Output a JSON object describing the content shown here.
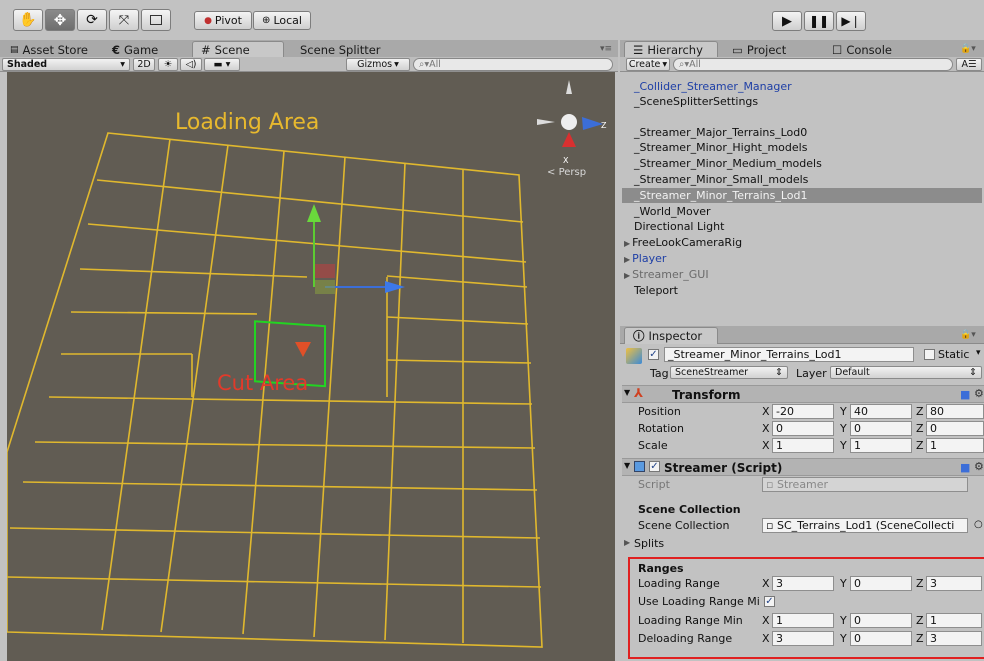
{
  "toolbar": {
    "pivot_label": "Pivot",
    "local_label": "Local"
  },
  "scene_panel": {
    "tabs": [
      {
        "label": "Asset Store"
      },
      {
        "label": "Game"
      },
      {
        "label": "Scene"
      },
      {
        "label": "Scene Splitter"
      }
    ],
    "shading_mode": "Shaded",
    "mode_2d": "2D",
    "gizmos_label": "Gizmos",
    "search_placeholder": "All",
    "persp_label": "Persp",
    "loading_area_label": "Loading Area",
    "cut_area_label": "Cut Area",
    "colors": {
      "grid": "#e0b82e",
      "cut": "#e03a2a",
      "cut_box": "#22d422",
      "background": "#615c53"
    }
  },
  "hierarchy": {
    "tabs": [
      {
        "label": "Hierarchy"
      },
      {
        "label": "Project"
      },
      {
        "label": "Console"
      }
    ],
    "create_label": "Create",
    "search_placeholder": "All",
    "items": [
      {
        "label": "_Collider_Streamer_Manager"
      },
      {
        "label": "_SceneSplitterSettings"
      },
      {
        "label": "_Streamer_Major_Terrains_Lod0"
      },
      {
        "label": "_Streamer_Minor_Hight_models"
      },
      {
        "label": "_Streamer_Minor_Medium_models"
      },
      {
        "label": "_Streamer_Minor_Small_models"
      },
      {
        "label": "_Streamer_Minor_Terrains_Lod1"
      },
      {
        "label": "_World_Mover"
      },
      {
        "label": "Directional Light"
      },
      {
        "label": "FreeLookCameraRig"
      },
      {
        "label": "Player"
      },
      {
        "label": "Streamer_GUI"
      },
      {
        "label": "Teleport"
      }
    ]
  },
  "inspector": {
    "tab_label": "Inspector",
    "object_name": "_Streamer_Minor_Terrains_Lod1",
    "static_label": "Static",
    "tag_label": "Tag",
    "tag_value": "SceneStreamer",
    "layer_label": "Layer",
    "layer_value": "Default",
    "transform": {
      "title": "Transform",
      "position": {
        "label": "Position",
        "x": "-20",
        "y": "40",
        "z": "80"
      },
      "rotation": {
        "label": "Rotation",
        "x": "0",
        "y": "0",
        "z": "0"
      },
      "scale": {
        "label": "Scale",
        "x": "1",
        "y": "1",
        "z": "1"
      }
    },
    "streamer": {
      "title": "Streamer (Script)",
      "script_label": "Script",
      "script_value": "Streamer",
      "scene_collection_header": "Scene Collection",
      "scene_collection_label": "Scene Collection",
      "scene_collection_value": "SC_Terrains_Lod1 (SceneCollecti",
      "splits_label": "Splits",
      "ranges_header": "Ranges",
      "loading_range": {
        "label": "Loading Range",
        "x": "3",
        "y": "0",
        "z": "3"
      },
      "use_loading_range_min": {
        "label": "Use Loading Range Mi",
        "checked": true
      },
      "loading_range_min": {
        "label": "Loading Range Min",
        "x": "1",
        "y": "0",
        "z": "1"
      },
      "deloading_range": {
        "label": "Deloading Range",
        "x": "3",
        "y": "0",
        "z": "3"
      }
    }
  },
  "axis_labels": {
    "x": "X",
    "y": "Y",
    "z": "Z"
  }
}
